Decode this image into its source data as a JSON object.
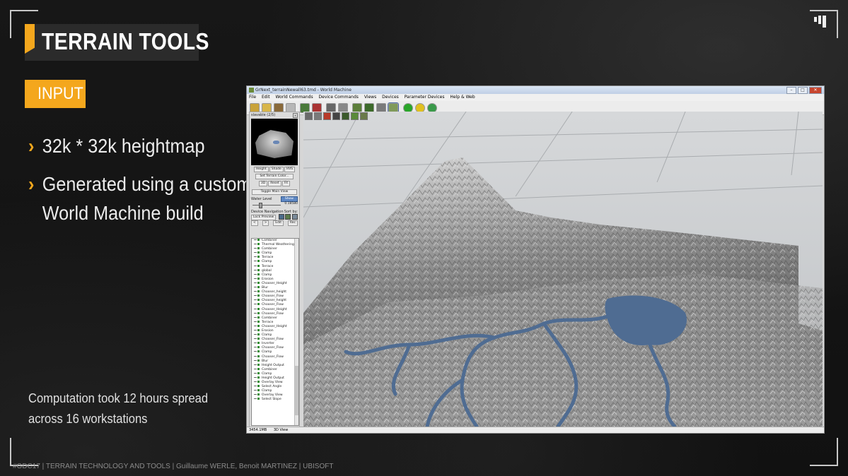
{
  "slide": {
    "title": "TERRAIN TOOLS",
    "section": "INPUT",
    "bullets": [
      {
        "lines": [
          "32k * 32k heightmap"
        ]
      },
      {
        "lines": [
          "Generated using a custom",
          "World Machine build"
        ]
      }
    ],
    "note_lines": [
      "Computation took 12 hours spread",
      "across 16 workstations"
    ],
    "footer": "#GDC17 | TERRAIN TECHNOLOGY AND TOOLS | Guillaume WERLE, Benoit MARTINEZ | UBISOFT",
    "bullet_glyph": "›",
    "colors": {
      "accent": "#f4a71d",
      "background": "#151515"
    }
  },
  "app": {
    "window_title": "GrNext_terrainNewall63.tmd - World Machine",
    "window_buttons": [
      "–",
      "□",
      "✕"
    ],
    "menu": [
      "File",
      "Edit",
      "World Commands",
      "Device Commands",
      "Views",
      "Devices",
      "Parameter Devices",
      "Help & Web"
    ],
    "toolbar_icons": [
      "open-file-icon",
      "save-icon",
      "build-icon",
      "tools-icon",
      "add-device-icon",
      "delete-icon",
      "library-icon",
      "export-icon",
      "terrain-view-icon",
      "grid-icon",
      "render-icon",
      "layout-view-icon",
      "green-orb-icon",
      "yellow-orb-icon",
      "green-globe-icon"
    ],
    "left_panel": {
      "header": "slavable (2/5)",
      "view_buttons": [
        "Height",
        "Shade",
        "HVS"
      ],
      "set_terrain_color": "Set Terrain Color...",
      "buttons_row": [
        "3D",
        "Reset",
        "Fit"
      ],
      "toggle_main_view": "Toggle Main View",
      "water_level_label": "Water Level",
      "water_level_button": "Show",
      "water_level_fraction": 0.25,
      "water_level_value": "0.18580",
      "device_navigation_label": "Device Navigation",
      "sort_by_label": "Sort by:",
      "lock_preview": "Lock Preview",
      "nav_buttons": [
        "<",
        ">",
        "Edit",
        "Rec"
      ],
      "devices": [
        "Combiner",
        "Thermal Weathering",
        "Combiner",
        "Clamp",
        "Terrace",
        "Clamp",
        "Terrace",
        "global",
        "Clamp",
        "Erosion",
        "Chooser_Height",
        "Blur",
        "Chooser_height",
        "Chooser_Flow",
        "Chooser_height",
        "Chooser_Flow",
        "Chooser_Height",
        "Chooser_Flow",
        "Combiner",
        "Terrace",
        "Chooser_Height",
        "Erosion",
        "Clamp",
        "Chooser_Flow",
        "Inverter",
        "Chooser_Flow",
        "Clamp",
        "Chooser_Flow",
        "Blur",
        "Height Output",
        "Combiner",
        "Clamp",
        "Height Output",
        "Overlay View",
        "Select Angle",
        "Clamp",
        "Overlay View",
        "Select Slope"
      ]
    },
    "viewport_toolbar": [
      "camera-icon",
      "render-icon",
      "record-icon",
      "cube-icon",
      "grid-view-icon",
      "paint-icon",
      "world-icon"
    ],
    "status": [
      "3454.1MB",
      "3D View"
    ]
  }
}
